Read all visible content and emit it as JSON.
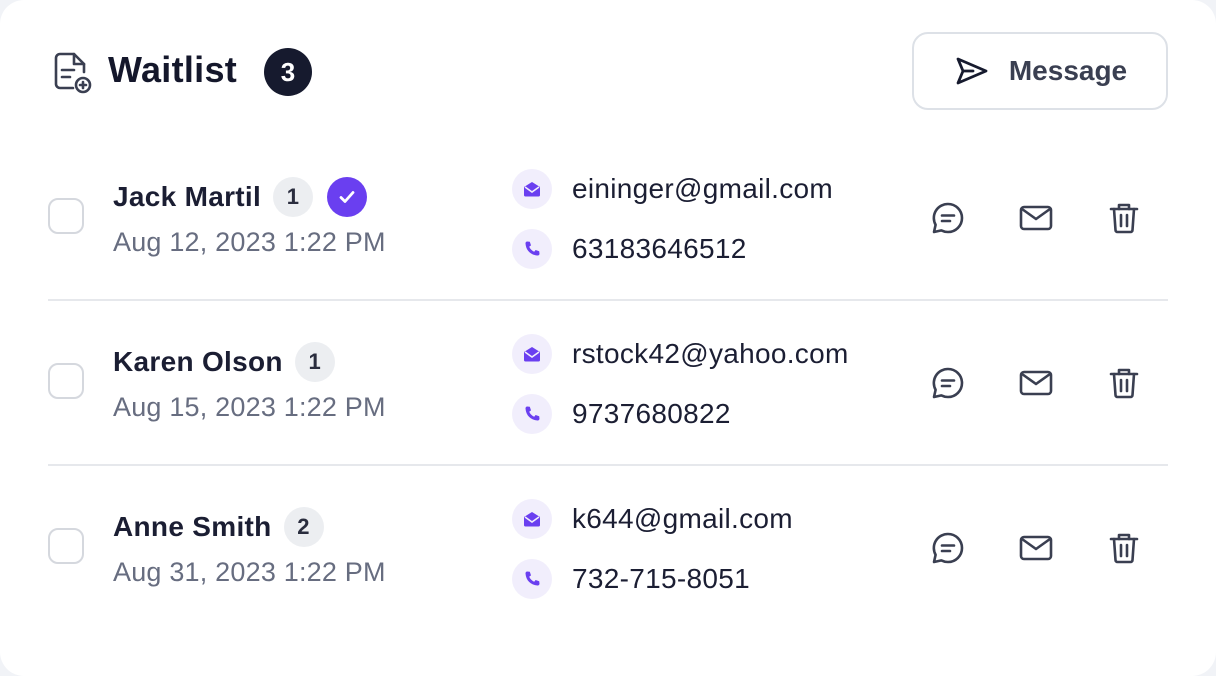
{
  "header": {
    "title": "Waitlist",
    "count": "3",
    "title_icon": "document-add-icon",
    "message_button": {
      "label": "Message",
      "icon": "send-icon"
    }
  },
  "colors": {
    "accent": "#6a3ff0",
    "accent_soft": "#f1eefc",
    "text_dark": "#161a2e",
    "text_muted": "#676d80",
    "divider": "#e6e8ec"
  },
  "entries": [
    {
      "name": "Jack Martil",
      "party_size": "1",
      "verified": true,
      "date": "Aug 12, 2023 1:22 PM",
      "email": "eininger@gmail.com",
      "phone": "63183646512"
    },
    {
      "name": "Karen Olson",
      "party_size": "1",
      "verified": false,
      "date": "Aug 15, 2023 1:22 PM",
      "email": "rstock42@yahoo.com",
      "phone": "9737680822"
    },
    {
      "name": "Anne Smith",
      "party_size": "2",
      "verified": false,
      "date": "Aug 31, 2023 1:22 PM",
      "email": "k644@gmail.com",
      "phone": "732-715-8051"
    }
  ],
  "row_actions": [
    "chat-icon",
    "mail-icon",
    "trash-icon"
  ]
}
